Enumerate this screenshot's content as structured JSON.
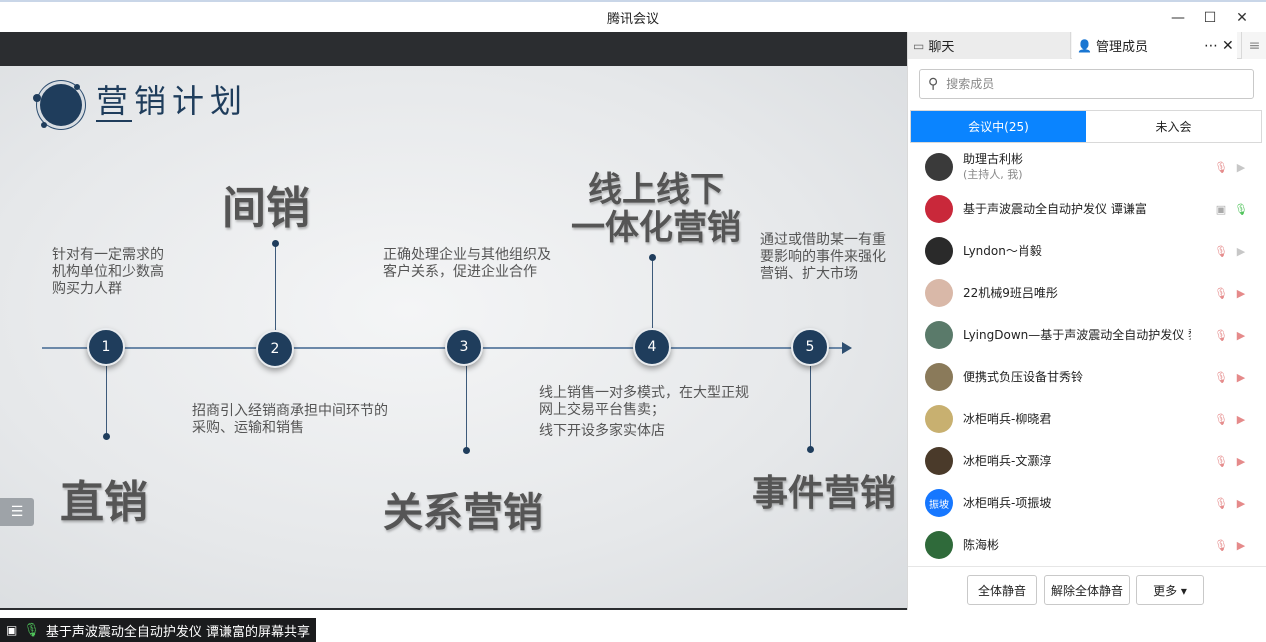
{
  "window": {
    "title": "腾讯会议",
    "minimize": "—",
    "maximize": "☐",
    "close": "✕"
  },
  "slide": {
    "title": "营销计划",
    "nodes": [
      "1",
      "2",
      "3",
      "4",
      "5"
    ],
    "items": [
      {
        "heading": "直销",
        "desc": "针对有一定需求的机构单位和少数高购买力人群"
      },
      {
        "heading": "间销",
        "desc": "招商引入经销商承担中间环节的采购、运输和销售"
      },
      {
        "heading": "关系营销",
        "desc": "正确处理企业与其他组织及客户关系，促进企业合作"
      },
      {
        "heading_line1": "线上线下",
        "heading_line2": "一体化营销",
        "desc_line1": "线上销售一对多模式，在大型正规网上交易平台售卖；",
        "desc_line2": "线下开设多家实体店"
      },
      {
        "heading": "事件营销",
        "desc": "通过或借助某一有重要影响的事件来强化营销、扩大市场"
      }
    ]
  },
  "share_status": {
    "text": "基于声波震动全自动护发仪 谭谦富的屏幕共享"
  },
  "panel": {
    "tab_chat": "聊天",
    "tab_members": "管理成员",
    "more": "⋯",
    "close": "✕",
    "menu": "≡",
    "search_placeholder": "搜索成员",
    "seg_in_meeting": "会议中(25)",
    "seg_not_joined": "未入会",
    "members": [
      {
        "name": "助理古利彬",
        "sub": "(主持人, 我)",
        "avatar_color": "#3a3a3a",
        "avatar_text": ""
      },
      {
        "name": "基于声波震动全自动护发仪 谭谦富",
        "sub": "",
        "avatar_color": "#c9283a",
        "avatar_text": ""
      },
      {
        "name": "Lyndon～肖毅",
        "sub": "",
        "avatar_color": "#2a2a2a",
        "avatar_text": ""
      },
      {
        "name": "22机械9班吕唯彤",
        "sub": "",
        "avatar_color": "#d9b8a8",
        "avatar_text": ""
      },
      {
        "name": "LyingDown—基于声波震动全自动护发仪 黎",
        "sub": "",
        "avatar_color": "#5a7a6a",
        "avatar_text": ""
      },
      {
        "name": "便携式负压设备甘秀铃",
        "sub": "",
        "avatar_color": "#8a7a5a",
        "avatar_text": ""
      },
      {
        "name": "冰柜哨兵-柳晓君",
        "sub": "",
        "avatar_color": "#c8b070",
        "avatar_text": ""
      },
      {
        "name": "冰柜哨兵-文灏淳",
        "sub": "",
        "avatar_color": "#4a3a2a",
        "avatar_text": ""
      },
      {
        "name": "冰柜哨兵-项振坡",
        "sub": "",
        "avatar_color": "#1677ff",
        "avatar_text": "振坡"
      },
      {
        "name": "陈海彬",
        "sub": "",
        "avatar_color": "#2f6a3a",
        "avatar_text": ""
      }
    ],
    "btn_mute_all": "全体静音",
    "btn_unmute_all": "解除全体静音",
    "btn_more": "更多 ▾"
  }
}
